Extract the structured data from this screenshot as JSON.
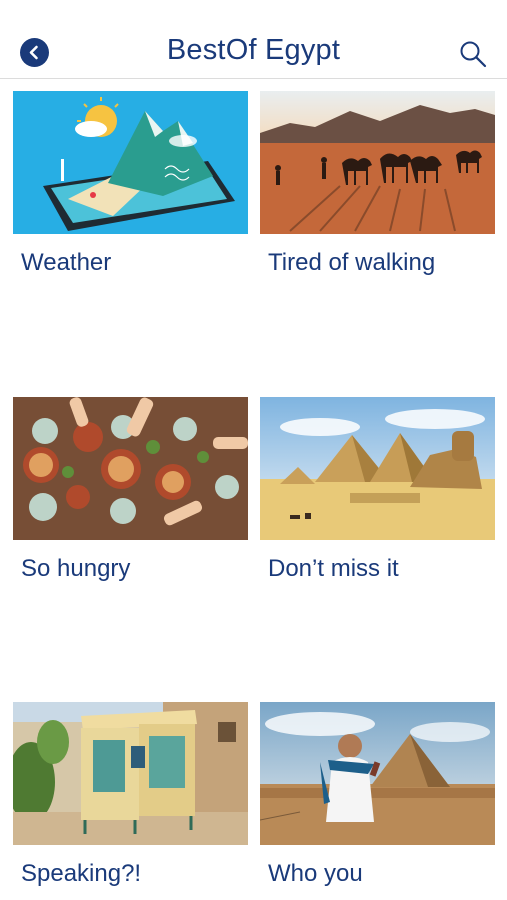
{
  "header": {
    "title": "BestOf Egypt"
  },
  "icons": {
    "back": "chevron-left-icon",
    "search": "search-icon"
  },
  "colors": {
    "brand": "#1a3a7a",
    "divider": "#dcdcdc"
  },
  "cards": [
    {
      "label": "Weather"
    },
    {
      "label": "Tired of walking"
    },
    {
      "label": "So hungry"
    },
    {
      "label": "Don’t miss it"
    },
    {
      "label": "Speaking?!"
    },
    {
      "label": "Who you"
    }
  ]
}
